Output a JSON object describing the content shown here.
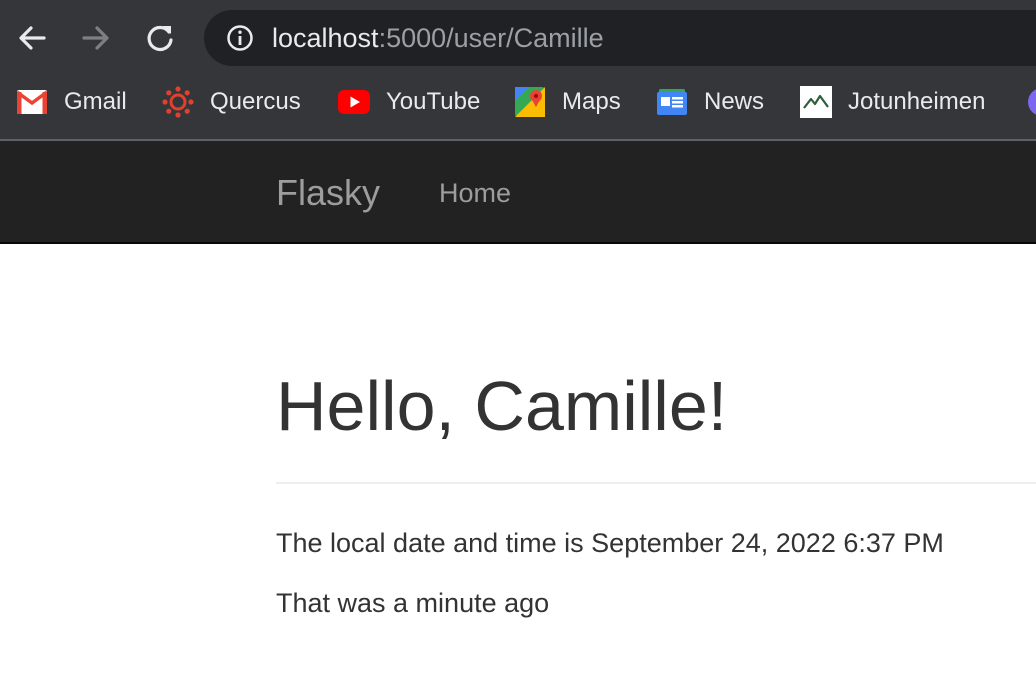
{
  "browser": {
    "url_host": "localhost",
    "url_path": ":5000/user/Camille",
    "bookmarks": [
      {
        "label": "Gmail",
        "icon": "gmail-icon"
      },
      {
        "label": "Quercus",
        "icon": "quercus-icon"
      },
      {
        "label": "YouTube",
        "icon": "youtube-icon"
      },
      {
        "label": "Maps",
        "icon": "maps-icon"
      },
      {
        "label": "News",
        "icon": "news-icon"
      },
      {
        "label": "Jotunheimen",
        "icon": "jotunheimen-icon"
      }
    ]
  },
  "navbar": {
    "brand": "Flasky",
    "home_label": "Home"
  },
  "main": {
    "greeting": "Hello, Camille!",
    "datetime_text": "The local date and time is September 24, 2022 6:37 PM",
    "relative_text": "That was a minute ago"
  },
  "colors": {
    "chrome_bg": "#35363a",
    "omnibox_bg": "#202124",
    "navbar_bg": "#222222",
    "nav_text": "#9d9d9d",
    "body_text": "#333333"
  }
}
